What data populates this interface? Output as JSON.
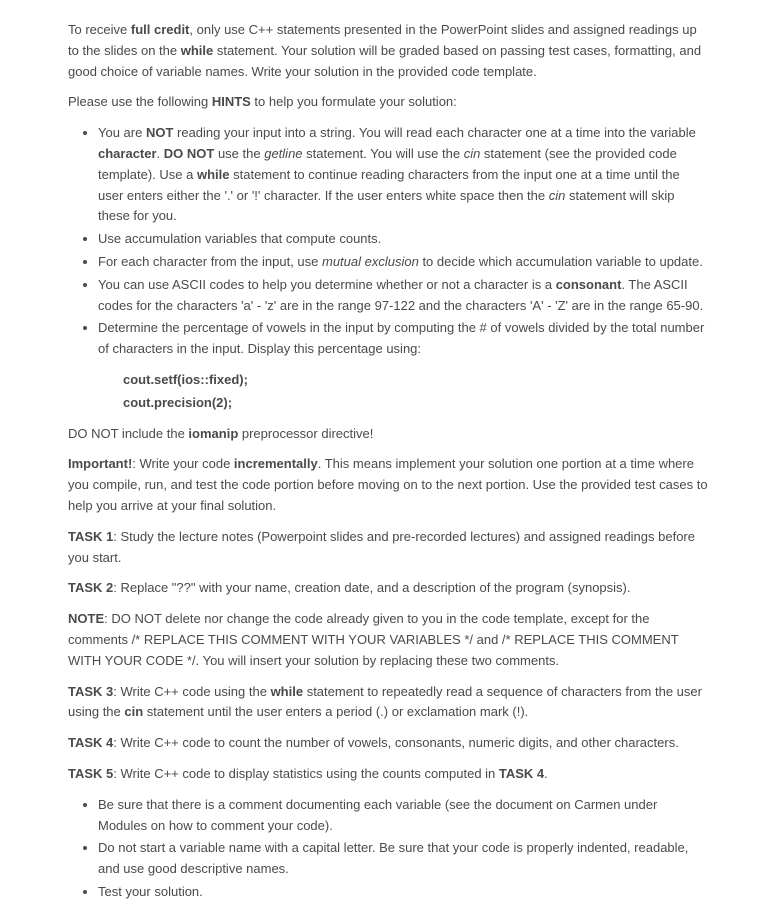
{
  "para1": {
    "pre1": "To receive ",
    "bold1": "full credit",
    "post1": ", only use C++ statements presented in the PowerPoint slides and assigned readings up to the slides on the ",
    "bold2": "while",
    "post2": " statement. Your solution will be graded based on passing test cases, formatting, and good choice of variable names. Write your solution in the provided code template."
  },
  "para2": {
    "pre": "Please use the following ",
    "bold": "HINTS",
    "post": " to help you formulate your solution:"
  },
  "hints": {
    "item1": {
      "t1": "You are ",
      "b1": "NOT",
      "t2": " reading your input into a string. You will read each character one at a time into the variable ",
      "b2": "character",
      "t3": ". ",
      "b3": "DO NOT",
      "t4": " use the ",
      "i1": "getline",
      "t5": " statement. You will use the ",
      "i2": "cin",
      "t6": " statement (see the provided code template). Use a ",
      "b4": "while",
      "t7": " statement to continue reading characters from the input one at a time until the user enters either the '.' or '!' character. If the user enters white space then the ",
      "i3": "cin",
      "t8": " statement will skip these for you."
    },
    "item2": "Use accumulation variables that compute counts.",
    "item3": {
      "t1": "For each character from the input, use ",
      "i1": "mutual exclusion",
      "t2": " to decide which accumulation variable to update."
    },
    "item4": {
      "t1": "You can use ASCII codes to help you determine whether or not a character is a ",
      "b1": "consonant",
      "t2": ". The ASCII codes for the characters 'a' - 'z' are in the range 97-122 and the characters 'A' - 'Z' are in the range 65-90."
    },
    "item5": "Determine the percentage of vowels in the input by computing the # of vowels divided by the total number of characters in the input. Display this percentage using:"
  },
  "code": {
    "line1": "cout.setf(ios::fixed);",
    "line2": "cout.precision(2);"
  },
  "para3": {
    "t1": "DO NOT include the ",
    "b1": "iomanip",
    "t2": " preprocessor directive!"
  },
  "para4": {
    "b1": "Important!",
    "t1": ": Write your code ",
    "b2": "incrementally",
    "t2": ". This means implement your solution one portion at a time where you compile, run, and test the code portion before moving on to the next portion. Use the provided test cases to help you arrive at your final solution."
  },
  "task1": {
    "label": "TASK 1",
    "text": ": Study the lecture notes (Powerpoint slides and pre-recorded lectures) and assigned readings before you start."
  },
  "task2": {
    "label": "TASK 2",
    "text": ": Replace \"??\" with your name, creation date, and a description of the program (synopsis)."
  },
  "note": {
    "label": "NOTE",
    "text": ": DO NOT delete nor change the code already given to you in the code template, except for the comments /* REPLACE THIS COMMENT WITH YOUR VARIABLES */ and /* REPLACE THIS COMMENT WITH YOUR CODE */. You will insert your solution by replacing these two comments."
  },
  "task3": {
    "label": "TASK 3",
    "t1": ": Write C++ code using the ",
    "b1": "while",
    "t2": " statement to repeatedly read a sequence of characters from the user using the ",
    "b2": "cin",
    "t3": " statement until the user enters a period (.) or exclamation mark (!)."
  },
  "task4": {
    "label": "TASK 4",
    "text": ": Write C++ code to count the number of vowels, consonants, numeric digits, and other characters."
  },
  "task5": {
    "label": "TASK 5",
    "t1": ": Write C++ code to display statistics using the counts computed in ",
    "b1": "TASK 4",
    "t2": "."
  },
  "footer": {
    "item1": "Be sure that there is a comment documenting each variable (see the document on Carmen under Modules on how to comment your code).",
    "item2": "Do not start a variable name with a capital letter. Be sure that your code is properly indented, readable, and use good descriptive names.",
    "item3": "Test your solution."
  }
}
